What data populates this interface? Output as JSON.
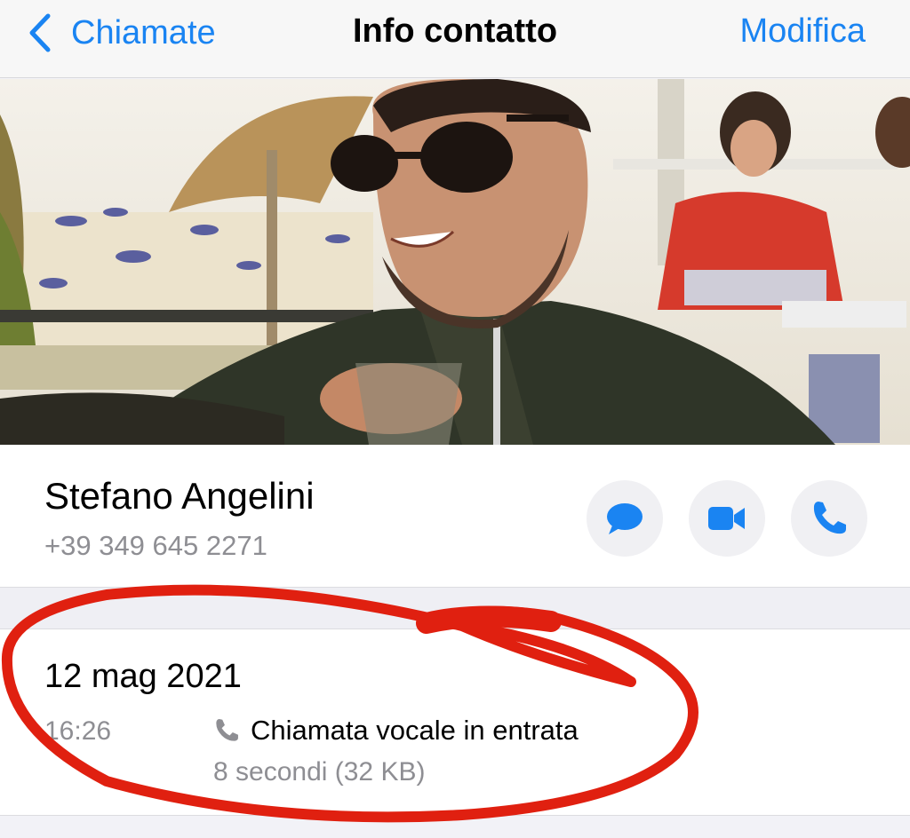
{
  "navbar": {
    "back_label": "Chiamate",
    "title": "Info contatto",
    "edit_label": "Modifica",
    "back_icon": "chevron-left-icon"
  },
  "contact": {
    "name": "Stefano Angelini",
    "phone": "+39 349 645 2271",
    "actions": [
      {
        "icon": "message-bubble-icon"
      },
      {
        "icon": "video-camera-icon"
      },
      {
        "icon": "phone-icon"
      }
    ]
  },
  "call": {
    "date": "12 mag 2021",
    "time": "16:26",
    "type_icon": "phone-icon",
    "type_label": "Chiamata vocale in entrata",
    "duration": "8 secondi (32 KB)"
  },
  "colors": {
    "accent": "#1a84f2",
    "annotation": "#e02010",
    "secondary_text": "#8e8e93"
  }
}
